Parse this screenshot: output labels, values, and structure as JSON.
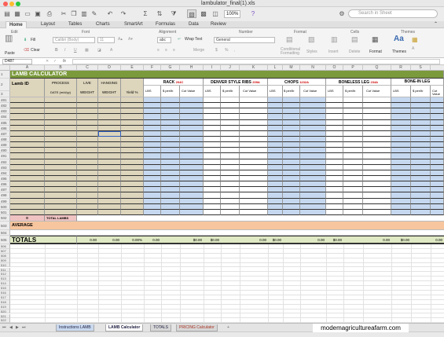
{
  "window": {
    "title": "lambulator_final(1).xls"
  },
  "toolbar": {
    "zoom": "100%",
    "search_placeholder": "Search in Sheet"
  },
  "ribbon_tabs": [
    "Home",
    "Layout",
    "Tables",
    "Charts",
    "SmartArt",
    "Formulas",
    "Data",
    "Review"
  ],
  "ribbon": {
    "groups": [
      "Edit",
      "Font",
      "Alignment",
      "Number",
      "Format",
      "Cells",
      "Themes"
    ],
    "paste": "Paste",
    "fill": "Fill",
    "clear": "Clear",
    "font_name": "Calibri (Body)",
    "font_size": "11",
    "align_abc": "abc",
    "wrap_text": "Wrap Text",
    "merge": "Merge",
    "number_format": "General",
    "conditional_formatting": "Conditional Formatting",
    "styles": "Styles",
    "insert": "Insert",
    "delete": "Delete",
    "format": "Format",
    "themes": "Themes",
    "aa": "Aa"
  },
  "formula_bar": {
    "cell_ref": "D487",
    "fx": "fx"
  },
  "columns": [
    "A",
    "B",
    "C",
    "D",
    "E",
    "F",
    "G",
    "H",
    "I",
    "J",
    "K",
    "L",
    "M",
    "N",
    "O",
    "P",
    "Q",
    "R",
    "S"
  ],
  "sheet": {
    "title": "LAMB CALCULATOR",
    "lamb_id": "Lamb ID",
    "process": "PROCESS",
    "process_date": "DATE (m/d/yy)",
    "live": "LIVE",
    "hanging": "HANGING",
    "weight": "WEIGHT",
    "yield": "Yield %",
    "cuts": [
      {
        "name": "RACK",
        "code": "204C"
      },
      {
        "name": "DENVER STYLE RIBS",
        "code": "209A"
      },
      {
        "name": "CHOPS",
        "code": "1232A"
      },
      {
        "name": "BONELESS LEG",
        "code": "234A"
      },
      {
        "name": "BONE-IN LEG",
        "code": ""
      }
    ],
    "sub_lbs": "LBS",
    "sub_price": "$ per/lb",
    "sub_cut": "Cut Value",
    "row_502_a": "0",
    "total_lambs": "TOTAL LAMBS",
    "average": "AVERAGE",
    "totals": "TOTALS",
    "totals_values": [
      "0.00",
      "0.00",
      "0.00%",
      "0.00",
      "$0.00",
      "$0.00",
      "0.00",
      "$0.00",
      "0.00",
      "$0.00",
      "0.00",
      "$0.00",
      "0.00"
    ]
  },
  "row_numbers": {
    "top": [
      "1",
      "2",
      "3"
    ],
    "body": [
      "481",
      "482",
      "483",
      "484",
      "485",
      "486",
      "487",
      "488",
      "489",
      "490",
      "491",
      "492",
      "493",
      "494",
      "495",
      "496",
      "497",
      "498",
      "499",
      "500",
      "501"
    ],
    "after": [
      "502",
      "503",
      "504",
      "505"
    ],
    "empty": [
      "506",
      "507",
      "508",
      "509",
      "510",
      "511",
      "512",
      "513",
      "514",
      "515",
      "516",
      "517",
      "518",
      "519",
      "520",
      "521",
      "522"
    ]
  },
  "sheet_tabs": [
    "Instructions LAMB",
    "LAMB Calculator",
    "TOTALS",
    "PRICING Calculator"
  ],
  "watermark": "modemagricultureafarm.com",
  "colors": {
    "title_green": "#7b9a3c",
    "tan": "#ddd5bc",
    "blue": "#c5d8ef",
    "pink": "#efc3c2",
    "orange": "#f7c59e",
    "green_totals": "#dfe9c4"
  }
}
